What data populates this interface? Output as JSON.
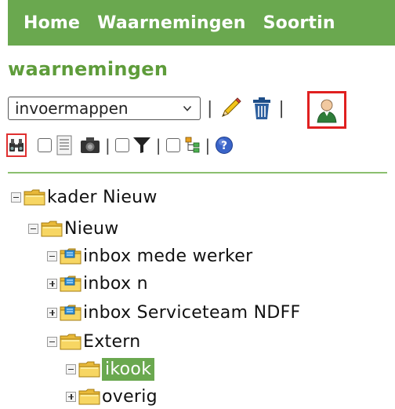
{
  "nav": {
    "items": [
      {
        "label": "Home"
      },
      {
        "label": "Waarnemingen"
      },
      {
        "label": "Soortin"
      }
    ]
  },
  "page": {
    "title": "waarnemingen"
  },
  "toolbar": {
    "select_value": "invoermappen",
    "separator": "|",
    "icons": [
      "pencil-icon",
      "trash-icon",
      "user-icon",
      "binoculars-icon",
      "document-icon",
      "camera-icon",
      "filter-icon",
      "tree-structure-icon",
      "help-icon"
    ]
  },
  "tree": {
    "nodes": [
      {
        "label": "kader Nieuw",
        "toggle": "minus",
        "folder": "plain"
      },
      {
        "label": "Nieuw",
        "toggle": "minus",
        "folder": "plain"
      },
      {
        "label": "inbox mede werker",
        "toggle": "minus",
        "folder": "inbox"
      },
      {
        "label": "inbox n",
        "toggle": "plus",
        "folder": "inbox"
      },
      {
        "label": "inbox Serviceteam NDFF",
        "toggle": "plus",
        "folder": "inbox"
      },
      {
        "label": "Extern",
        "toggle": "minus",
        "folder": "plain"
      },
      {
        "label": "ikook",
        "toggle": "minus",
        "folder": "plain",
        "selected": true
      },
      {
        "label": "overig",
        "toggle": "plus",
        "folder": "plain"
      }
    ]
  },
  "colors": {
    "brand_green": "#6aa84f",
    "title_green": "#5e9c3a",
    "highlight_red": "#e02020"
  }
}
